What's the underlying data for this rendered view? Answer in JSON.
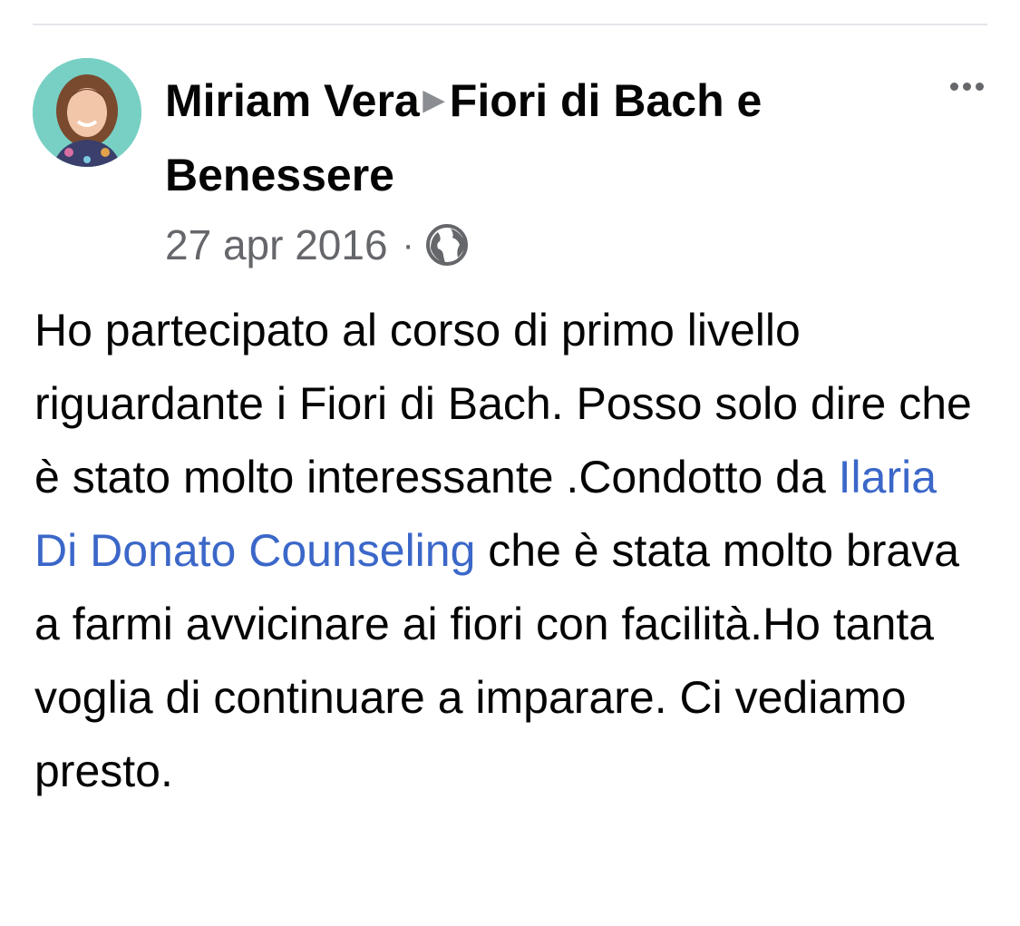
{
  "post": {
    "author": "Miriam Vera",
    "arrow": "▶",
    "group": "Fiori di Bach e Benessere",
    "date": "27 apr 2016",
    "separator": "·",
    "privacy_icon": "globe-icon",
    "more_icon": "more-options-icon",
    "body": {
      "text_before": "Ho partecipato al corso di primo livello riguardante i Fiori di Bach. Posso solo dire che è stato molto interessante .Condotto da ",
      "mention": "Ilaria Di Donato Counseling",
      "text_after": " che è stata molto brava a farmi avvicinare ai fiori con facilità.Ho tanta voglia di continuare a imparare. Ci vediamo presto."
    }
  },
  "colors": {
    "text": "#050505",
    "secondary": "#65676b",
    "link": "#3b67c9",
    "divider": "#e4e6eb"
  }
}
